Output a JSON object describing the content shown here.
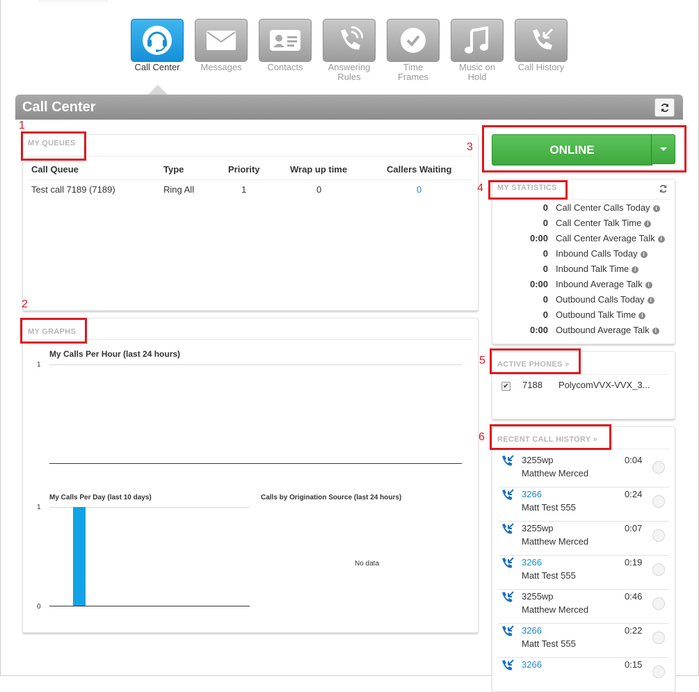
{
  "nav": [
    {
      "label_lines": [
        "Call Center"
      ],
      "icon": "headset-icon",
      "active": true
    },
    {
      "label_lines": [
        "Messages"
      ],
      "icon": "envelope-icon",
      "active": false
    },
    {
      "label_lines": [
        "Contacts"
      ],
      "icon": "contact-card-icon",
      "active": false
    },
    {
      "label_lines": [
        "Answering",
        "Rules"
      ],
      "icon": "phone-ringing-icon",
      "active": false
    },
    {
      "label_lines": [
        "Time",
        "Frames"
      ],
      "icon": "clock-icon",
      "active": false
    },
    {
      "label_lines": [
        "Music on",
        "Hold"
      ],
      "icon": "music-note-icon",
      "active": false
    },
    {
      "label_lines": [
        "Call History"
      ],
      "icon": "phone-history-icon",
      "active": false
    }
  ],
  "page_title": "Call Center",
  "annotations": [
    "1",
    "2",
    "3",
    "4",
    "5",
    "6"
  ],
  "queues": {
    "title": "MY QUEUES",
    "headers": [
      "Call Queue",
      "Type",
      "Priority",
      "Wrap up time",
      "Callers Waiting"
    ],
    "rows": [
      {
        "queue": "Test call 7189 (7189)",
        "type": "Ring All",
        "priority": "1",
        "wrap_up": "0",
        "callers_waiting": "0"
      }
    ]
  },
  "graphs": {
    "title": "MY GRAPHS",
    "no_data": "No data"
  },
  "chart_data": [
    {
      "type": "line",
      "title": "My Calls Per Hour (last 24 hours)",
      "ylim": [
        0,
        1
      ],
      "ytick_labels": [
        "1"
      ],
      "series": []
    },
    {
      "type": "bar",
      "title": "My Calls Per Day (last 10 days)",
      "ylim": [
        0,
        1
      ],
      "ytick_labels": [
        "1",
        "0"
      ],
      "values": [
        0,
        1,
        0,
        0,
        0,
        0,
        0,
        0,
        0,
        0
      ],
      "bar_color": "#12a2e6"
    },
    {
      "type": "pie",
      "title": "Calls by Origination Source (last 24 hours)",
      "values": []
    }
  ],
  "status": {
    "label": "ONLINE",
    "color": "#4cb84a"
  },
  "statistics": {
    "title": "MY STATISTICS",
    "rows": [
      {
        "value": "0",
        "label": "Call Center Calls Today"
      },
      {
        "value": "0",
        "label": "Call Center Talk Time"
      },
      {
        "value": "0:00",
        "label": "Call Center Average Talk"
      },
      {
        "value": "0",
        "label": "Inbound Calls Today"
      },
      {
        "value": "0",
        "label": "Inbound Talk Time"
      },
      {
        "value": "0:00",
        "label": "Inbound Average Talk"
      },
      {
        "value": "0",
        "label": "Outbound Calls Today"
      },
      {
        "value": "0",
        "label": "Outbound Talk Time"
      },
      {
        "value": "0:00",
        "label": "Outbound Average Talk"
      }
    ]
  },
  "active_phones": {
    "title": "ACTIVE PHONES »",
    "rows": [
      {
        "extension": "7188",
        "device": "PolycomVVX-VVX_3..."
      }
    ]
  },
  "recent_history": {
    "title": "RECENT CALL HISTORY »",
    "rows": [
      {
        "number": "3255wp",
        "name": "Matthew Merced",
        "duration": "0:04",
        "link": false
      },
      {
        "number": "3266",
        "name": "Matt Test 555",
        "duration": "0:24",
        "link": true
      },
      {
        "number": "3255wp",
        "name": "Matthew Merced",
        "duration": "0:07",
        "link": false
      },
      {
        "number": "3266",
        "name": "Matt Test 555",
        "duration": "0:19",
        "link": true
      },
      {
        "number": "3255wp",
        "name": "Matthew Merced",
        "duration": "0:46",
        "link": false
      },
      {
        "number": "3266",
        "name": "Matt Test 555",
        "duration": "0:22",
        "link": true
      },
      {
        "number": "3266",
        "name": "",
        "duration": "0:15",
        "link": true
      }
    ]
  }
}
